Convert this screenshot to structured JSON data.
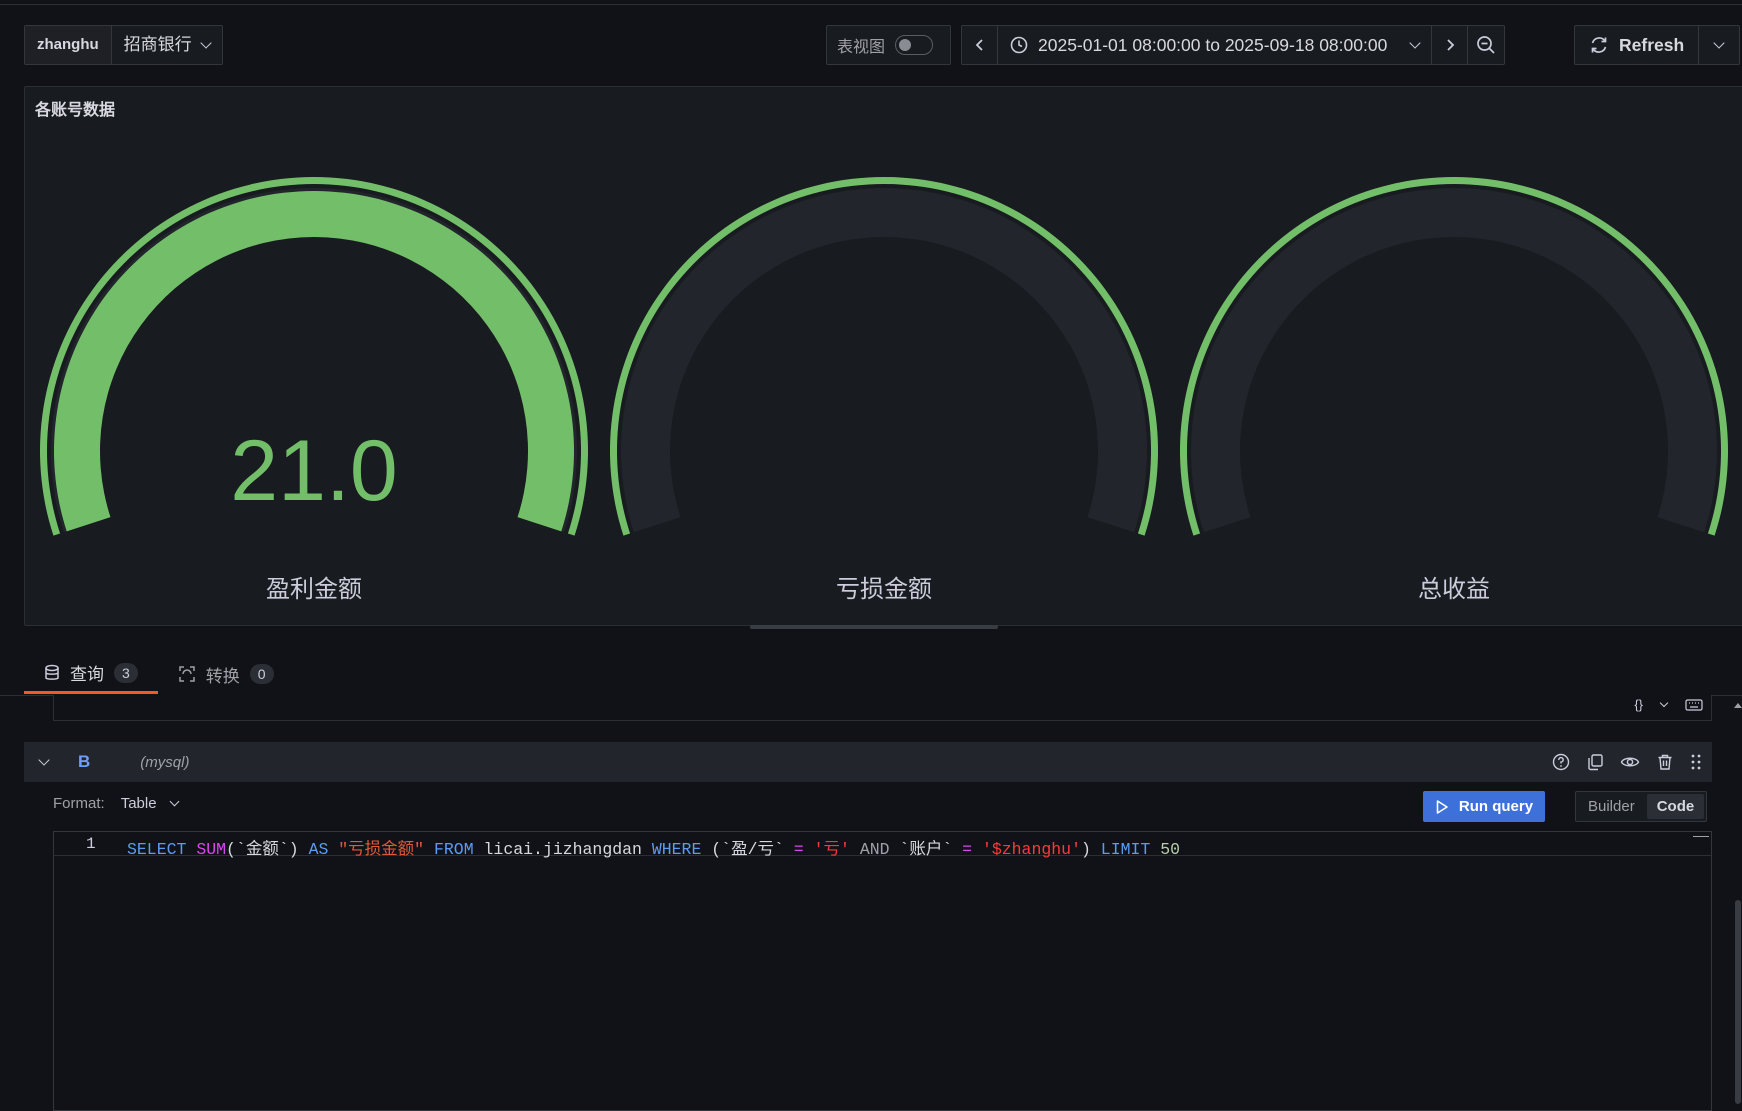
{
  "toolbar": {
    "var_label": "zhanghu",
    "var_value": "招商银行",
    "table_view_label": "表视图",
    "time_range": "2025-01-01 08:00:00 to 2025-09-18 08:00:00",
    "refresh_label": "Refresh"
  },
  "panel": {
    "title": "各账号数据",
    "gauges": [
      {
        "label": "盈利金额",
        "value_text": "21.0",
        "fill_fraction": 1.0
      },
      {
        "label": "亏损金额",
        "value_text": "",
        "fill_fraction": 0
      },
      {
        "label": "总收益",
        "value_text": "",
        "fill_fraction": 0
      }
    ],
    "colors": {
      "green": "#73bf69",
      "track": "#22252b"
    }
  },
  "tabs": [
    {
      "label": "查询",
      "count": "3"
    },
    {
      "label": "转换",
      "count": "0"
    }
  ],
  "query": {
    "name": "B",
    "datasource": "(mysql)",
    "format_label": "Format:",
    "format_value": "Table",
    "run_label": "Run query",
    "mode_builder": "Builder",
    "mode_code": "Code",
    "line_number": "1",
    "sql": {
      "t1": "SELECT",
      "t2": "SUM",
      "t3": "(`金额`) ",
      "t4": "AS",
      "t5": "\"亏损金额\"",
      "t6": "FROM",
      "t7": " licai.jizhangdan ",
      "t8": "WHERE",
      "t9": " (`盈/亏` ",
      "t10": "=",
      "t11": "'亏'",
      "t12": "AND",
      "t13": " `账户` ",
      "t14": "=",
      "t15": "'$zhanghu'",
      "t16": ") ",
      "t17": "LIMIT",
      "t18": "50"
    }
  }
}
